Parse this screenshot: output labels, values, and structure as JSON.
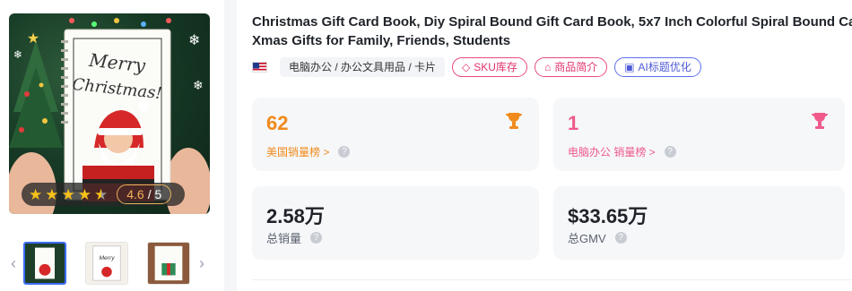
{
  "product": {
    "title_line1": "Christmas Gift Card Book, Diy Spiral Bound Gift Card Book, 5x7 Inch Colorful Spiral Bound Card",
    "title_line2": "Xmas Gifts for Family, Friends, Students",
    "cover_text": "Merry Christmas!",
    "rating": "4.6",
    "rating_max": "/ 5",
    "rating_stars": 4.6
  },
  "tags": {
    "country_flag": "us-flag-icon",
    "category_path": "电脑办公 / 办公文具用品 / 卡片",
    "sku_label": "SKU库存",
    "intro_label": "商品简介",
    "ai_label": "AI标题优化"
  },
  "stats": {
    "us_rank": {
      "value": "62",
      "label": "美国销量榜 >"
    },
    "cat_rank": {
      "value": "1",
      "label": "电脑办公 销量榜 >"
    },
    "total_sales": {
      "value": "2.58万",
      "label": "总销量"
    },
    "total_gmv": {
      "value": "$33.65万",
      "label": "总GMV"
    }
  },
  "colors": {
    "orange": "#f08a1c",
    "pink": "#ef5a8a",
    "ai_blue": "#4f5bd5"
  }
}
